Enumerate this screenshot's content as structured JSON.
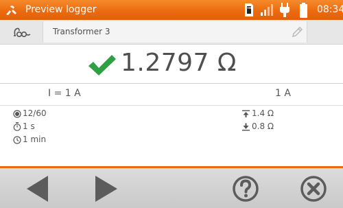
{
  "statusbar": {
    "title": "Preview logger",
    "time": "08:34"
  },
  "record": {
    "name": "Transformer 3"
  },
  "result": {
    "value": "1.2797 Ω",
    "status": "pass"
  },
  "current": {
    "set_label": "I = 1 A",
    "measured": "1 A"
  },
  "details": {
    "count": "12/60",
    "interval": "1 s",
    "duration": "1 min",
    "upper_limit": "1.4 Ω",
    "lower_limit": "0.8 Ω"
  },
  "colors": {
    "accent": "#ec6b0f",
    "pass": "#2ea043"
  },
  "icons": {
    "app": "logger-icon",
    "sd": "sd-card-icon",
    "signal": "signal-icon",
    "power": "plug-icon",
    "battery": "battery-icon",
    "name": "coil-icon",
    "edit": "pencil-icon",
    "result": "check-icon",
    "prev": "arrow-left-icon",
    "next": "arrow-right-icon",
    "help": "help-icon",
    "close": "close-icon"
  }
}
